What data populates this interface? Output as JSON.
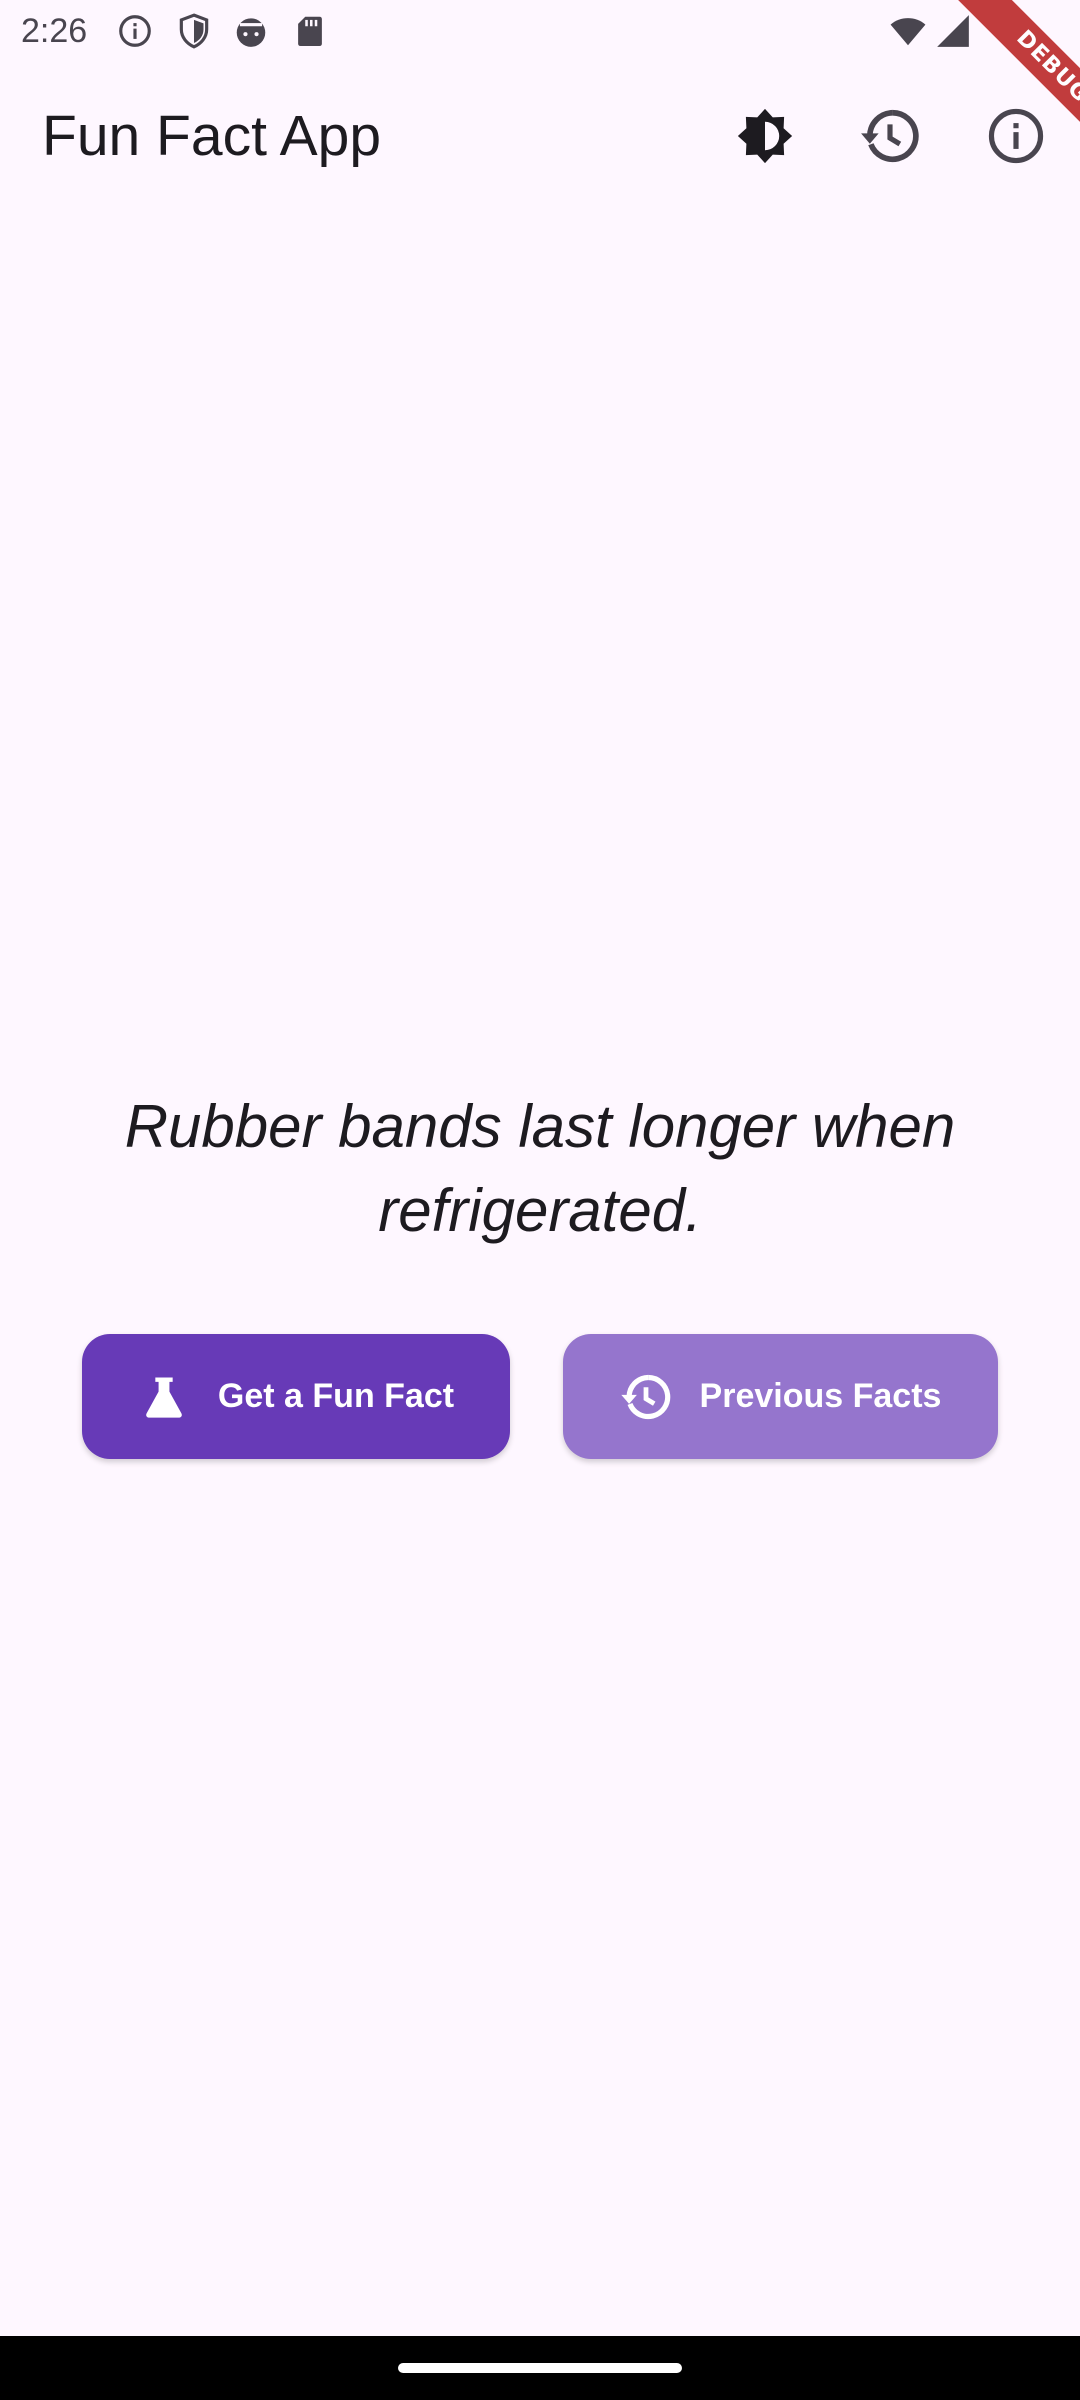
{
  "status_bar": {
    "time": "2:26",
    "icons": [
      "info-outline-icon",
      "shield-icon",
      "android-face-icon",
      "sd-card-icon",
      "wifi-icon",
      "signal-icon"
    ]
  },
  "debug_banner": {
    "label": "DEBUG",
    "color": "#B71C1C"
  },
  "app_bar": {
    "title": "Fun Fact App",
    "actions": [
      "brightness-icon",
      "history-icon",
      "info-icon"
    ]
  },
  "main": {
    "fact": "Rubber bands last longer when refrigerated."
  },
  "buttons": {
    "get_fact_label": "Get a Fun Fact",
    "get_fact_icon": "flask-icon",
    "previous_label": "Previous Facts",
    "previous_icon": "history-icon"
  },
  "colors": {
    "background": "#FEF7FF",
    "primary": "#673AB7",
    "secondary": "#9575CD",
    "text": "#1D1B20"
  }
}
